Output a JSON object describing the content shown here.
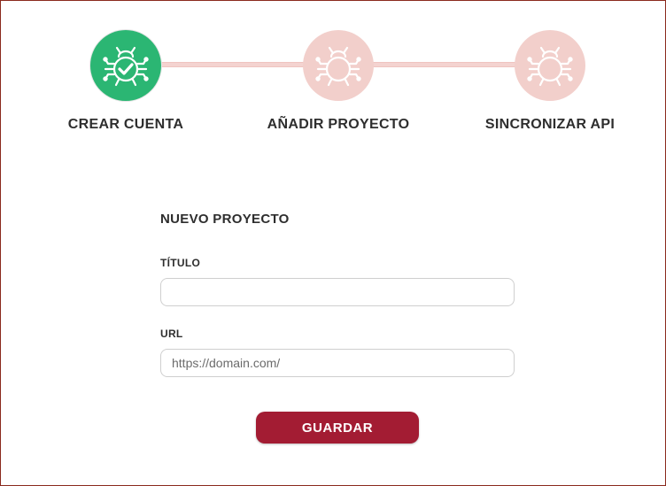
{
  "stepper": {
    "steps": [
      {
        "label": "CREAR CUENTA",
        "status": "completed",
        "icon": "bug-check-icon",
        "color": "#2bb673"
      },
      {
        "label": "AÑADIR PROYECTO",
        "status": "pending",
        "icon": "bug-icon",
        "color": "#f2cfcb"
      },
      {
        "label": "SINCRONIZAR API",
        "status": "pending",
        "icon": "bug-icon",
        "color": "#f2cfcb"
      }
    ],
    "connector_color": "#f4d3d0"
  },
  "form": {
    "title": "NUEVO PROYECTO",
    "titulo_label": "TÍTULO",
    "titulo_value": "",
    "titulo_placeholder": "",
    "url_label": "URL",
    "url_value": "",
    "url_placeholder": "https://domain.com/"
  },
  "actions": {
    "save_label": "GUARDAR",
    "save_color": "#a31c33"
  }
}
